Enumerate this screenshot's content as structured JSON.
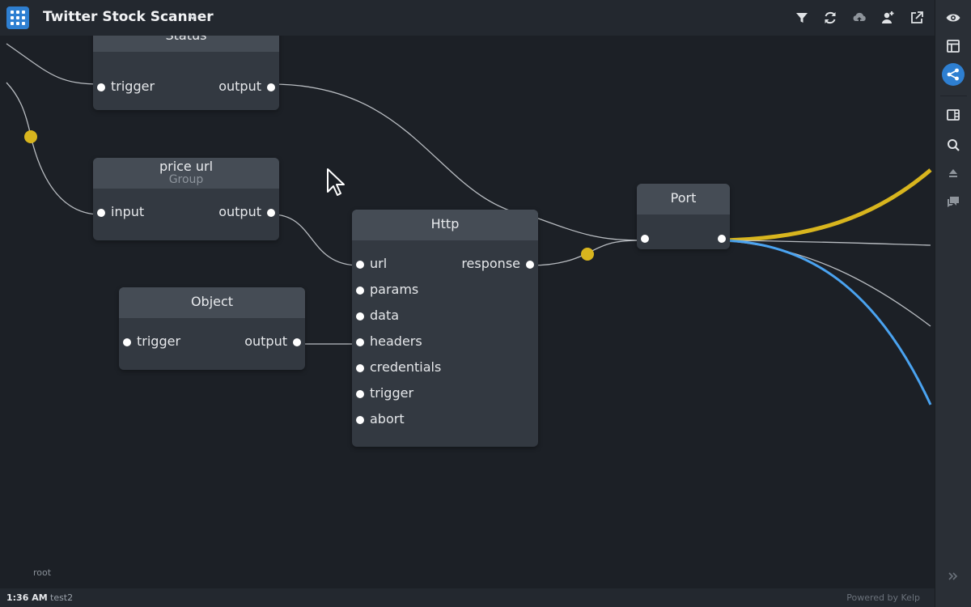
{
  "header": {
    "title": "Twitter Stock Scanner",
    "icons": [
      "app-grid-icon",
      "chevron-down-icon",
      "filter-icon",
      "refresh-icon",
      "cloud-upload-icon",
      "add-user-icon",
      "external-link-icon"
    ]
  },
  "rail": {
    "icons": [
      "eye-icon",
      "layout-icon",
      "node-graph-icon",
      "panel-icon",
      "search-icon",
      "eject-icon",
      "comments-icon",
      "expand-icon"
    ],
    "active": "node-graph-icon"
  },
  "canvas": {
    "breadcrumb": "root",
    "nodes": {
      "status": {
        "title": "Status",
        "inputs": [
          "trigger"
        ],
        "outputs": [
          "output"
        ]
      },
      "price_url": {
        "title": "price url",
        "subtitle": "Group",
        "inputs": [
          "input"
        ],
        "outputs": [
          "output"
        ]
      },
      "object": {
        "title": "Object",
        "inputs": [
          "trigger"
        ],
        "outputs": [
          "output"
        ]
      },
      "http": {
        "title": "Http",
        "inputs": [
          "url",
          "params",
          "data",
          "headers",
          "credentials",
          "trigger",
          "abort"
        ],
        "outputs": [
          "response"
        ]
      },
      "port": {
        "title": "Port"
      }
    }
  },
  "statusbar": {
    "time": "1:36 AM",
    "project": "test2",
    "powered": "Powered by Kelp"
  },
  "colors": {
    "accent": "#2e7fd1",
    "wire_yellow": "#d8b51e",
    "wire_blue": "#4aa3f0",
    "wire_default": "#b9bdc2"
  }
}
